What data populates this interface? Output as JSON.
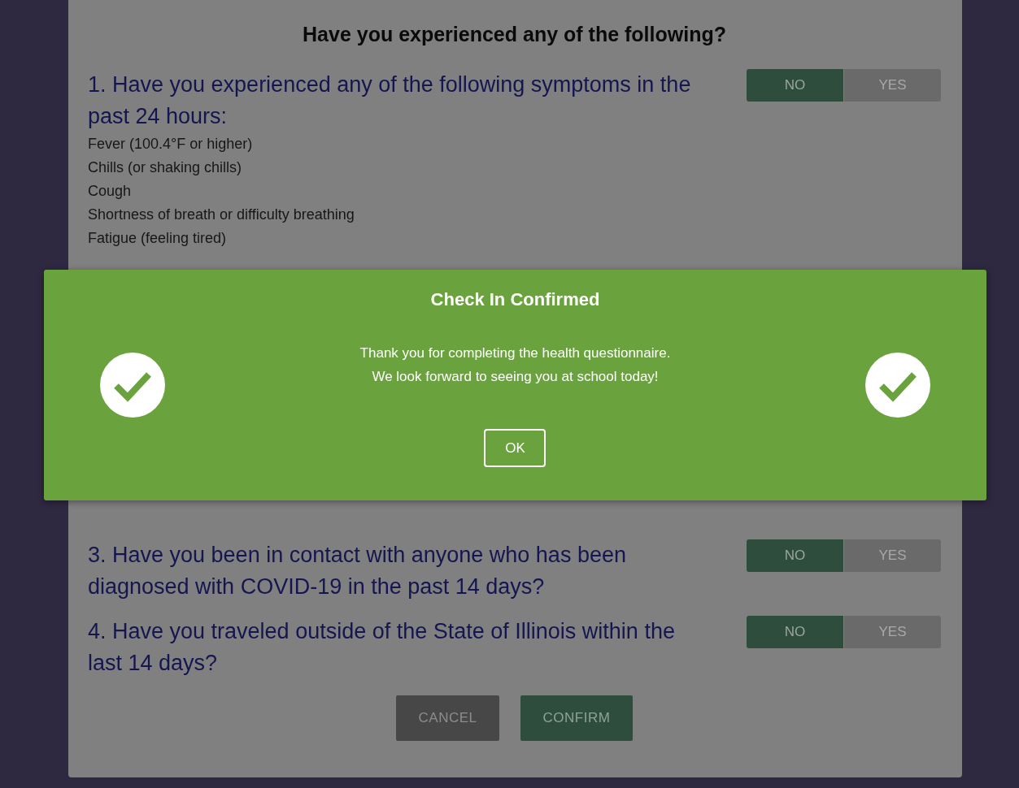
{
  "form": {
    "heading": "Have you experienced any of the following?",
    "questions": [
      {
        "text": "1. Have you experienced any of the following symptoms in the past 24 hours:",
        "items": [
          "Fever (100.4°F or higher)",
          "Chills (or shaking chills)",
          "Cough",
          "Shortness of breath or difficulty breathing",
          "Fatigue (feeling tired)"
        ],
        "options": [
          {
            "label": "NO",
            "selected": true
          },
          {
            "label": "YES",
            "selected": false
          }
        ]
      },
      {
        "text": "3. Have you been in contact with anyone who has been diagnosed with COVID-19 in the past 14 days?",
        "options": [
          {
            "label": "NO",
            "selected": true
          },
          {
            "label": "YES",
            "selected": false
          }
        ]
      },
      {
        "text": "4. Have you traveled outside of the State of Illinois within the last 14 days?",
        "options": [
          {
            "label": "NO",
            "selected": true
          },
          {
            "label": "YES",
            "selected": false
          }
        ]
      }
    ],
    "buttons": [
      {
        "label": "CANCEL",
        "kind": "cancel"
      },
      {
        "label": "CONFIRM",
        "kind": "confirm"
      }
    ]
  },
  "dialog": {
    "title": "Check In Confirmed",
    "message": [
      "Thank you for completing the health questionnaire.",
      "We look forward to seeing you at school today!"
    ],
    "button": "OK"
  }
}
